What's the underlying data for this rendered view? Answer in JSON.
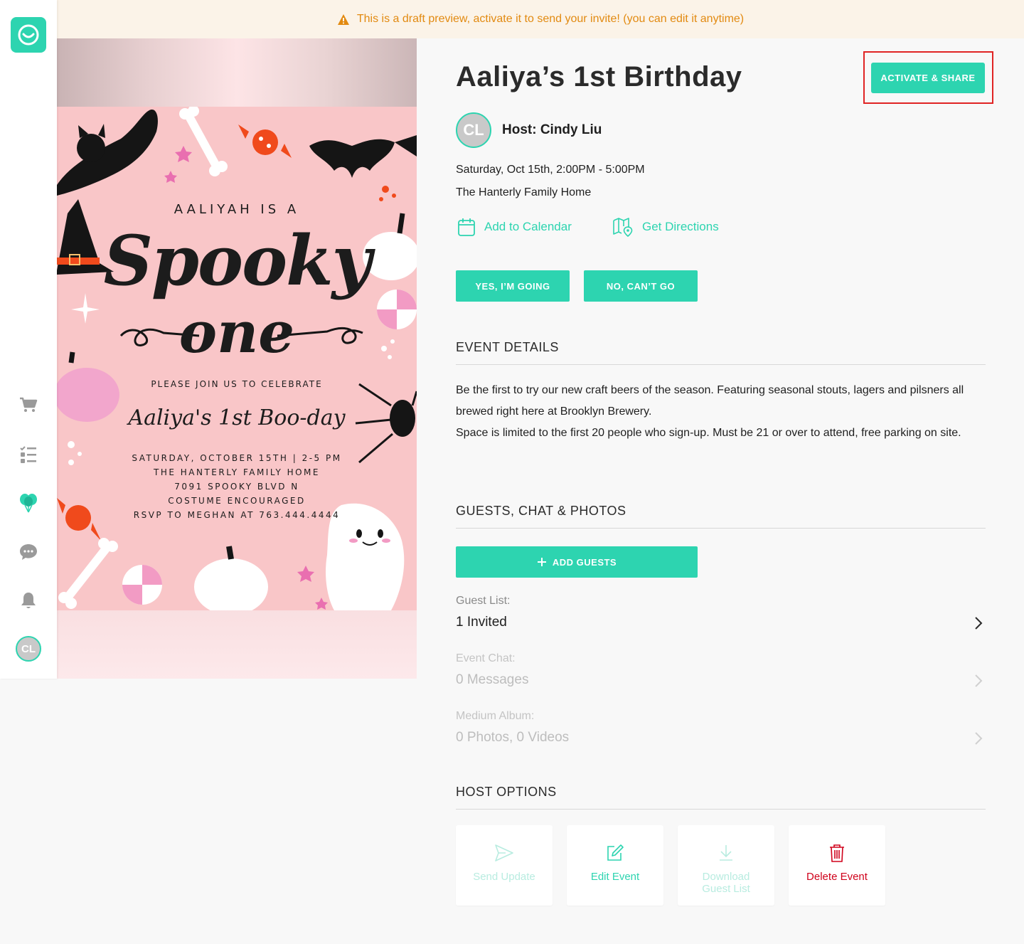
{
  "banner": {
    "icon": "warning-icon",
    "text": "This is a draft preview, activate it to send your invite! (you can edit it anytime)"
  },
  "sidebar": {
    "logo": "app-logo",
    "items": [
      {
        "name": "cart-icon"
      },
      {
        "name": "checklist-icon"
      },
      {
        "name": "balloons-icon"
      },
      {
        "name": "chat-icon"
      },
      {
        "name": "bell-icon"
      }
    ],
    "avatar": "CL"
  },
  "invitation": {
    "line1": "AALIYAH IS A",
    "script1": "Spooky",
    "script2": "one",
    "line2": "PLEASE JOIN US TO CELEBRATE",
    "script3": "Aaliya's 1st Boo-day",
    "details": [
      "SATURDAY, OCTOBER 15TH | 2-5 PM",
      "THE HANTERLY FAMILY HOME",
      "7091 SPOOKY BLVD N",
      "COSTUME ENCOURAGED",
      "RSVP TO MEGHAN AT 763.444.4444"
    ]
  },
  "event": {
    "title": "Aaliya’s 1st Birthday",
    "activate_label": "ACTIVATE & SHARE",
    "host_initials": "CL",
    "host": "Host: Cindy Liu",
    "when": "Saturday, Oct 15th, 2:00PM - 5:00PM",
    "where": "The Hanterly Family Home",
    "add_calendar": "Add to Calendar",
    "get_directions": "Get Directions",
    "yes_label": "YES, I’M GOING",
    "no_label": "NO, CAN’T GO"
  },
  "details_section": {
    "heading": "EVENT DETAILS",
    "para1": "Be the first to try our new craft beers of the season. Featuring seasonal stouts, lagers and pilsners all brewed right here at Brooklyn Brewery.",
    "para2": "Space is limited to the first 20 people who sign-up. Must be 21 or over to attend, free parking on site."
  },
  "guests_section": {
    "heading": "GUESTS, CHAT & PHOTOS",
    "add_guests": "ADD GUESTS",
    "guest_list_label": "Guest List:",
    "guest_list_value": "1 Invited",
    "chat_label": "Event Chat:",
    "chat_value": "0 Messages",
    "album_label": "Medium Album:",
    "album_value": "0 Photos, 0 Videos"
  },
  "host_options": {
    "heading": "HOST OPTIONS",
    "send_update": "Send Update",
    "edit_event": "Edit Event",
    "download_1": "Download",
    "download_2": "Guest List",
    "delete_event": "Delete Event"
  },
  "colors": {
    "accent": "#2dd4b0",
    "warning": "#e28a11",
    "danger": "#d0021b",
    "highlight": "#e02424"
  }
}
